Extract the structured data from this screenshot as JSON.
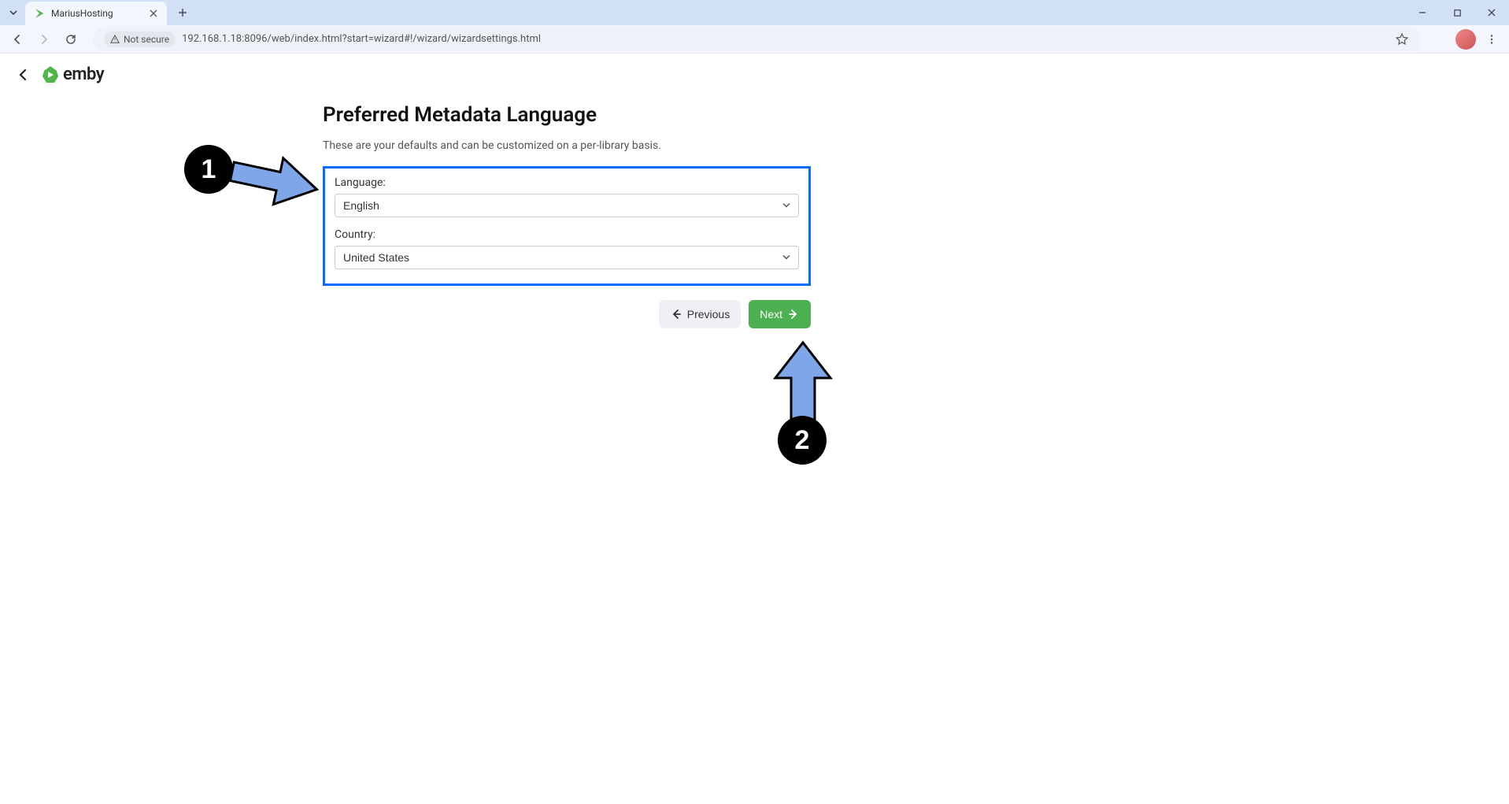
{
  "browser": {
    "tab_title": "MariusHosting",
    "not_secure_label": "Not secure",
    "url": "192.168.1.18:8096/web/index.html?start=wizard#!/wizard/wizardsettings.html"
  },
  "app": {
    "brand": "emby"
  },
  "wizard": {
    "title": "Preferred Metadata Language",
    "description": "These are your defaults and can be customized on a per-library basis.",
    "language_label": "Language:",
    "language_value": "English",
    "country_label": "Country:",
    "country_value": "United States",
    "previous_label": "Previous",
    "next_label": "Next"
  },
  "annotations": {
    "step1": "1",
    "step2": "2"
  },
  "colors": {
    "highlight": "#0a6cff",
    "next_btn": "#4caf50",
    "arrow_fill": "#7ea6e8"
  }
}
